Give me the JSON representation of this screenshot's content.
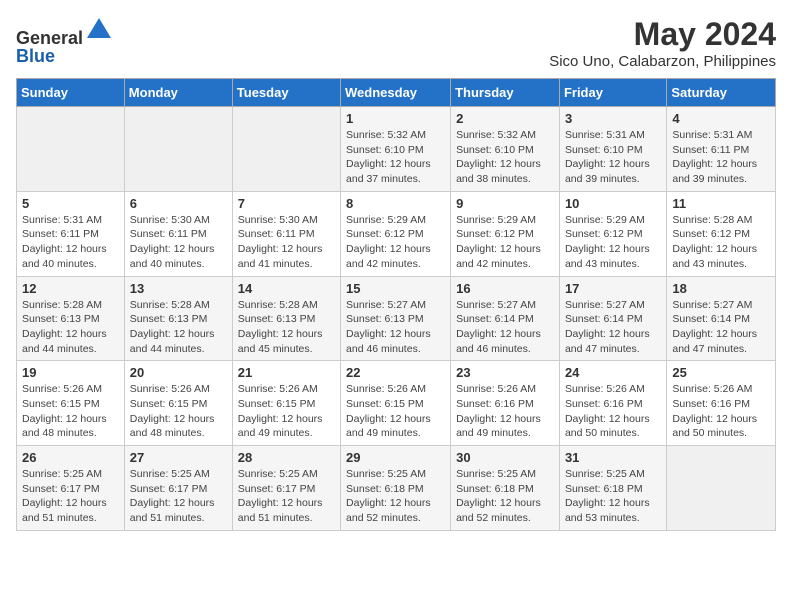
{
  "header": {
    "logo_line1": "General",
    "logo_line2": "Blue",
    "title": "May 2024",
    "subtitle": "Sico Uno, Calabarzon, Philippines"
  },
  "days_of_week": [
    "Sunday",
    "Monday",
    "Tuesday",
    "Wednesday",
    "Thursday",
    "Friday",
    "Saturday"
  ],
  "weeks": [
    [
      {
        "num": "",
        "sunrise": "",
        "sunset": "",
        "daylight": ""
      },
      {
        "num": "",
        "sunrise": "",
        "sunset": "",
        "daylight": ""
      },
      {
        "num": "",
        "sunrise": "",
        "sunset": "",
        "daylight": ""
      },
      {
        "num": "1",
        "sunrise": "5:32 AM",
        "sunset": "6:10 PM",
        "daylight": "12 hours and 37 minutes."
      },
      {
        "num": "2",
        "sunrise": "5:32 AM",
        "sunset": "6:10 PM",
        "daylight": "12 hours and 38 minutes."
      },
      {
        "num": "3",
        "sunrise": "5:31 AM",
        "sunset": "6:10 PM",
        "daylight": "12 hours and 39 minutes."
      },
      {
        "num": "4",
        "sunrise": "5:31 AM",
        "sunset": "6:11 PM",
        "daylight": "12 hours and 39 minutes."
      }
    ],
    [
      {
        "num": "5",
        "sunrise": "5:31 AM",
        "sunset": "6:11 PM",
        "daylight": "12 hours and 40 minutes."
      },
      {
        "num": "6",
        "sunrise": "5:30 AM",
        "sunset": "6:11 PM",
        "daylight": "12 hours and 40 minutes."
      },
      {
        "num": "7",
        "sunrise": "5:30 AM",
        "sunset": "6:11 PM",
        "daylight": "12 hours and 41 minutes."
      },
      {
        "num": "8",
        "sunrise": "5:29 AM",
        "sunset": "6:12 PM",
        "daylight": "12 hours and 42 minutes."
      },
      {
        "num": "9",
        "sunrise": "5:29 AM",
        "sunset": "6:12 PM",
        "daylight": "12 hours and 42 minutes."
      },
      {
        "num": "10",
        "sunrise": "5:29 AM",
        "sunset": "6:12 PM",
        "daylight": "12 hours and 43 minutes."
      },
      {
        "num": "11",
        "sunrise": "5:28 AM",
        "sunset": "6:12 PM",
        "daylight": "12 hours and 43 minutes."
      }
    ],
    [
      {
        "num": "12",
        "sunrise": "5:28 AM",
        "sunset": "6:13 PM",
        "daylight": "12 hours and 44 minutes."
      },
      {
        "num": "13",
        "sunrise": "5:28 AM",
        "sunset": "6:13 PM",
        "daylight": "12 hours and 44 minutes."
      },
      {
        "num": "14",
        "sunrise": "5:28 AM",
        "sunset": "6:13 PM",
        "daylight": "12 hours and 45 minutes."
      },
      {
        "num": "15",
        "sunrise": "5:27 AM",
        "sunset": "6:13 PM",
        "daylight": "12 hours and 46 minutes."
      },
      {
        "num": "16",
        "sunrise": "5:27 AM",
        "sunset": "6:14 PM",
        "daylight": "12 hours and 46 minutes."
      },
      {
        "num": "17",
        "sunrise": "5:27 AM",
        "sunset": "6:14 PM",
        "daylight": "12 hours and 47 minutes."
      },
      {
        "num": "18",
        "sunrise": "5:27 AM",
        "sunset": "6:14 PM",
        "daylight": "12 hours and 47 minutes."
      }
    ],
    [
      {
        "num": "19",
        "sunrise": "5:26 AM",
        "sunset": "6:15 PM",
        "daylight": "12 hours and 48 minutes."
      },
      {
        "num": "20",
        "sunrise": "5:26 AM",
        "sunset": "6:15 PM",
        "daylight": "12 hours and 48 minutes."
      },
      {
        "num": "21",
        "sunrise": "5:26 AM",
        "sunset": "6:15 PM",
        "daylight": "12 hours and 49 minutes."
      },
      {
        "num": "22",
        "sunrise": "5:26 AM",
        "sunset": "6:15 PM",
        "daylight": "12 hours and 49 minutes."
      },
      {
        "num": "23",
        "sunrise": "5:26 AM",
        "sunset": "6:16 PM",
        "daylight": "12 hours and 49 minutes."
      },
      {
        "num": "24",
        "sunrise": "5:26 AM",
        "sunset": "6:16 PM",
        "daylight": "12 hours and 50 minutes."
      },
      {
        "num": "25",
        "sunrise": "5:26 AM",
        "sunset": "6:16 PM",
        "daylight": "12 hours and 50 minutes."
      }
    ],
    [
      {
        "num": "26",
        "sunrise": "5:25 AM",
        "sunset": "6:17 PM",
        "daylight": "12 hours and 51 minutes."
      },
      {
        "num": "27",
        "sunrise": "5:25 AM",
        "sunset": "6:17 PM",
        "daylight": "12 hours and 51 minutes."
      },
      {
        "num": "28",
        "sunrise": "5:25 AM",
        "sunset": "6:17 PM",
        "daylight": "12 hours and 51 minutes."
      },
      {
        "num": "29",
        "sunrise": "5:25 AM",
        "sunset": "6:18 PM",
        "daylight": "12 hours and 52 minutes."
      },
      {
        "num": "30",
        "sunrise": "5:25 AM",
        "sunset": "6:18 PM",
        "daylight": "12 hours and 52 minutes."
      },
      {
        "num": "31",
        "sunrise": "5:25 AM",
        "sunset": "6:18 PM",
        "daylight": "12 hours and 53 minutes."
      },
      {
        "num": "",
        "sunrise": "",
        "sunset": "",
        "daylight": ""
      }
    ]
  ]
}
